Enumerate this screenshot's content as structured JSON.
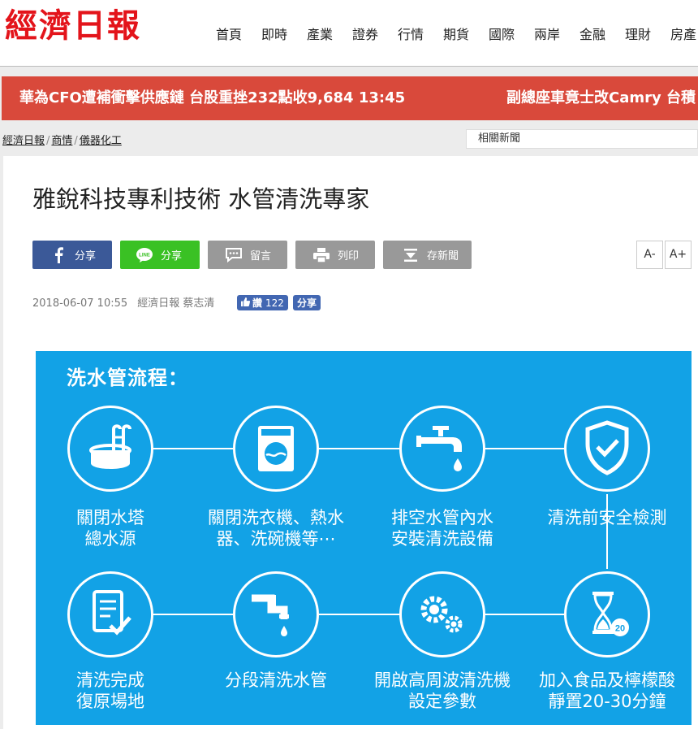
{
  "header": {
    "logo": "經濟日報",
    "nav": [
      "首頁",
      "即時",
      "產業",
      "證券",
      "行情",
      "期貨",
      "國際",
      "兩岸",
      "金融",
      "理財",
      "房產"
    ]
  },
  "ticker": {
    "items": [
      "華為CFO遭補衝擊供應鏈 台股重挫232點收9,684 13:45",
      "副總座車竟士改Camry 台積"
    ]
  },
  "breadcrumb": {
    "items": [
      "經濟日報",
      "商情",
      "儀器化工"
    ]
  },
  "related": {
    "label": "相關新聞"
  },
  "article": {
    "title": "雅銳科技專利技術 水管清洗專家",
    "share_buttons": [
      "分享",
      "分享",
      "留言",
      "列印",
      "存新聞"
    ],
    "font_minus": "A-",
    "font_plus": "A+",
    "date": "2018-06-07 10:55",
    "source": "經濟日報 蔡志清",
    "like_label": "讚",
    "like_count": "122",
    "fb_share": "分享"
  },
  "figure": {
    "title": "洗水管流程：",
    "steps": [
      {
        "line1": "關閉水塔",
        "line2": "總水源"
      },
      {
        "line1": "關閉洗衣機、熱水",
        "line2": "器、洗碗機等⋯"
      },
      {
        "line1": "排空水管內水",
        "line2": "安裝清洗設備"
      },
      {
        "line1": "清洗前安全檢測",
        "line2": ""
      },
      {
        "line1": "清洗完成",
        "line2": "復原場地"
      },
      {
        "line1": "分段清洗水管",
        "line2": ""
      },
      {
        "line1": "開啟高周波清洗機",
        "line2": "設定參數"
      },
      {
        "line1": "加入食品及檸檬酸",
        "line2": "靜置20-30分鐘"
      }
    ],
    "timer_badge": "20"
  },
  "colors": {
    "brand_red": "#e3141b",
    "ticker_bg": "#d9493b",
    "facebook": "#3b5998",
    "line": "#3ac124",
    "gray_button": "#999999",
    "figure_bg": "#12a2e6"
  }
}
